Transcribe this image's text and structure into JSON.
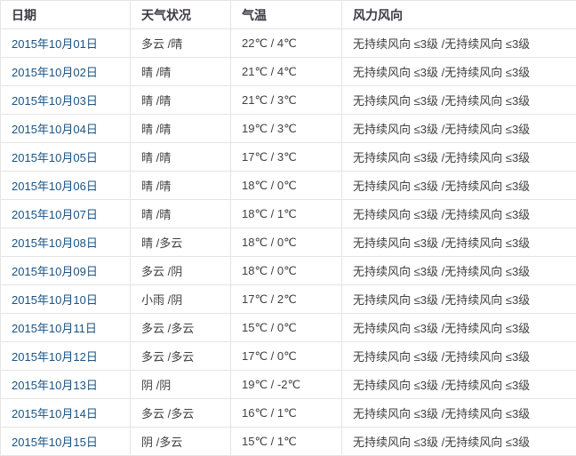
{
  "colors": {
    "link": "#1b5382",
    "header_text": "#3e3a45",
    "body_text": "#404040",
    "border": "#e4e4e4",
    "background": "#ffffff"
  },
  "table": {
    "columns": [
      "日期",
      "天气状况",
      "气温",
      "风力风向"
    ],
    "rows": [
      {
        "date": "2015年10月01日",
        "weather": "多云 /晴",
        "temperature": "22℃ / 4℃",
        "wind": "无持续风向 ≤3级 /无持续风向 ≤3级"
      },
      {
        "date": "2015年10月02日",
        "weather": "晴 /晴",
        "temperature": "21℃ / 4℃",
        "wind": "无持续风向 ≤3级 /无持续风向 ≤3级"
      },
      {
        "date": "2015年10月03日",
        "weather": "晴 /晴",
        "temperature": "21℃ / 3℃",
        "wind": "无持续风向 ≤3级 /无持续风向 ≤3级"
      },
      {
        "date": "2015年10月04日",
        "weather": "晴 /晴",
        "temperature": "19℃ / 3℃",
        "wind": "无持续风向 ≤3级 /无持续风向 ≤3级"
      },
      {
        "date": "2015年10月05日",
        "weather": "晴 /晴",
        "temperature": "17℃ / 3℃",
        "wind": "无持续风向 ≤3级 /无持续风向 ≤3级"
      },
      {
        "date": "2015年10月06日",
        "weather": "晴 /晴",
        "temperature": "18℃ / 0℃",
        "wind": "无持续风向 ≤3级 /无持续风向 ≤3级"
      },
      {
        "date": "2015年10月07日",
        "weather": "晴 /晴",
        "temperature": "18℃ / 1℃",
        "wind": "无持续风向 ≤3级 /无持续风向 ≤3级"
      },
      {
        "date": "2015年10月08日",
        "weather": "晴 /多云",
        "temperature": "18℃ / 0℃",
        "wind": "无持续风向 ≤3级 /无持续风向 ≤3级"
      },
      {
        "date": "2015年10月09日",
        "weather": "多云 /阴",
        "temperature": "18℃ / 0℃",
        "wind": "无持续风向 ≤3级 /无持续风向 ≤3级"
      },
      {
        "date": "2015年10月10日",
        "weather": "小雨 /阴",
        "temperature": "17℃ / 2℃",
        "wind": "无持续风向 ≤3级 /无持续风向 ≤3级"
      },
      {
        "date": "2015年10月11日",
        "weather": "多云 /多云",
        "temperature": "15℃ / 0℃",
        "wind": "无持续风向 ≤3级 /无持续风向 ≤3级"
      },
      {
        "date": "2015年10月12日",
        "weather": "多云 /多云",
        "temperature": "17℃ / 0℃",
        "wind": "无持续风向 ≤3级 /无持续风向 ≤3级"
      },
      {
        "date": "2015年10月13日",
        "weather": "阴 /阴",
        "temperature": "19℃ / -2℃",
        "wind": "无持续风向 ≤3级 /无持续风向 ≤3级"
      },
      {
        "date": "2015年10月14日",
        "weather": "多云 /多云",
        "temperature": "16℃ / 1℃",
        "wind": "无持续风向 ≤3级 /无持续风向 ≤3级"
      },
      {
        "date": "2015年10月15日",
        "weather": "阴 /多云",
        "temperature": "15℃ / 1℃",
        "wind": "无持续风向 ≤3级 /无持续风向 ≤3级"
      }
    ]
  }
}
